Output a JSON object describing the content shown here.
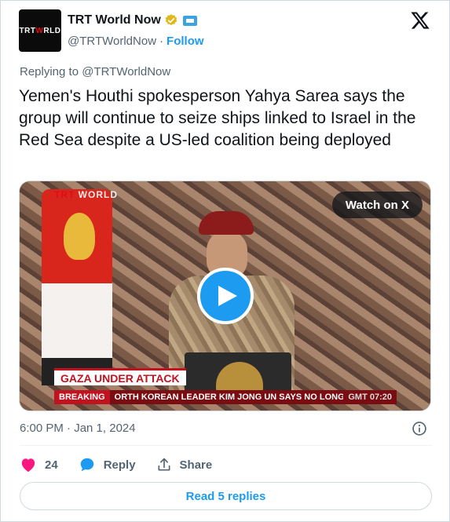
{
  "author": {
    "display_name": "TRT World Now",
    "handle": "@TRTWorldNow",
    "separator": "·",
    "follow_label": "Follow",
    "avatar_text_a": "TRT",
    "avatar_text_b": "W",
    "avatar_text_c": "RLD"
  },
  "replying_to": "Replying to @TRTWorldNow",
  "tweet_text": "Yemen's Houthi spokesperson Yahya Sarea says the group will continue to seize ships linked to Israel in the Red Sea despite a US-led coalition being deployed",
  "media": {
    "watch_label": "Watch on X",
    "brand_a": "TRT",
    "brand_b": "WORLD",
    "lower_third": "GAZA UNDER ATTACK",
    "ticker_label": "BREAKING",
    "ticker_text": "ORTH KOREAN LEADER KIM JONG UN SAYS NO LONGER SEEI",
    "ticker_time": "GMT 07:20"
  },
  "timestamp": "6:00 PM · Jan 1, 2024",
  "actions": {
    "like_count": "24",
    "reply_label": "Reply",
    "share_label": "Share"
  },
  "read_replies_label": "Read 5 replies",
  "colors": {
    "accent": "#1d9bf0",
    "like": "#f91880",
    "muted": "#536471",
    "text": "#0f1419",
    "verified_gold": "#e2b719"
  },
  "icons": [
    "x-logo-icon",
    "verified-badge-icon",
    "affiliation-icon",
    "play-icon",
    "info-icon",
    "heart-icon",
    "reply-bubble-icon",
    "share-icon"
  ]
}
